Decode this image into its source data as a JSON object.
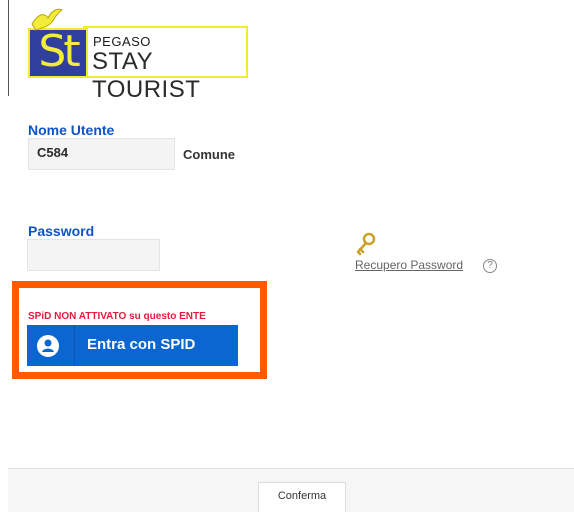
{
  "logo": {
    "mark": "St",
    "line1": "PEGASO",
    "line2": "STAY TOURIST"
  },
  "form": {
    "username_label": "Nome Utente",
    "username_value": "C584",
    "comune_label": "Comune",
    "password_label": "Password",
    "password_value": "",
    "recover_label": "Recupero Password",
    "help_glyph": "?"
  },
  "spid": {
    "warning": "SPiD NON ATTIVATO su questo ENTE",
    "button_label": "Entra con SPID"
  },
  "footer": {
    "confirm_label": "Conferma"
  },
  "colors": {
    "label_blue": "#0d54c8",
    "spid_blue": "#0b66d1",
    "highlight_orange": "#ff5a00",
    "warning_red": "#e11c3c",
    "logo_yellow": "#f4ec3a",
    "logo_navy": "#2f3f9b"
  },
  "icons": [
    "pegasus-icon",
    "key-icon",
    "help-icon",
    "user-icon"
  ]
}
